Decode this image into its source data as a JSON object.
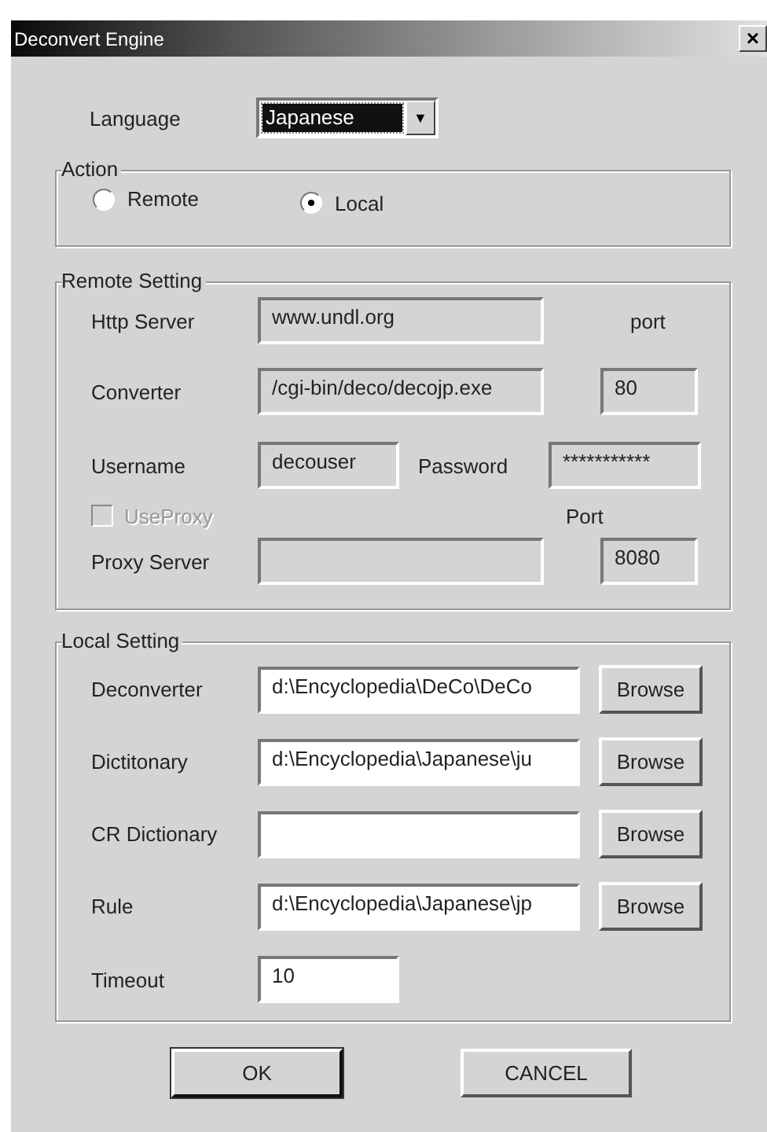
{
  "window": {
    "title": "Deconvert Engine",
    "close": "×"
  },
  "language": {
    "label": "Language",
    "value": "Japanese",
    "arrow": "▼"
  },
  "action": {
    "title": "Action",
    "options": [
      {
        "label": "Remote",
        "selected": false
      },
      {
        "label": "Local",
        "selected": true
      }
    ]
  },
  "remote_setting": {
    "title": "Remote Setting",
    "disabled": true,
    "http_server": {
      "label": "Http Server",
      "value": "www.undl.org"
    },
    "port_label": "port",
    "converter": {
      "label": "Converter",
      "value": "/cgi-bin/deco/decojp.exe"
    },
    "port": "80",
    "username": {
      "label": "Username",
      "value": "decouser"
    },
    "password": {
      "label": "Password",
      "value": "***********"
    },
    "use_proxy": {
      "label": "UseProxy",
      "checked": false,
      "disabled": true
    },
    "proxy_port_label": "Port",
    "proxy_server": {
      "label": "Proxy Server"
    },
    "proxy_port": "8080"
  },
  "local_setting": {
    "title": "Local Setting",
    "rows": [
      {
        "label": "Deconverter",
        "value": "d:\\Encyclopedia\\DeCo\\DeCo",
        "button": "Browse"
      },
      {
        "label": "Dictitonary",
        "value": "d:\\Encyclopedia\\Japanese\\ju",
        "button": "Browse"
      },
      {
        "label": "CR Dictionary",
        "button": "Browse"
      },
      {
        "label": "Rule",
        "value": "d:\\Encyclopedia\\Japanese\\jp",
        "button": "Browse"
      }
    ],
    "timeout": {
      "label": "Timeout",
      "value": "10"
    }
  },
  "buttons": [
    "OK",
    "CANCEL"
  ]
}
